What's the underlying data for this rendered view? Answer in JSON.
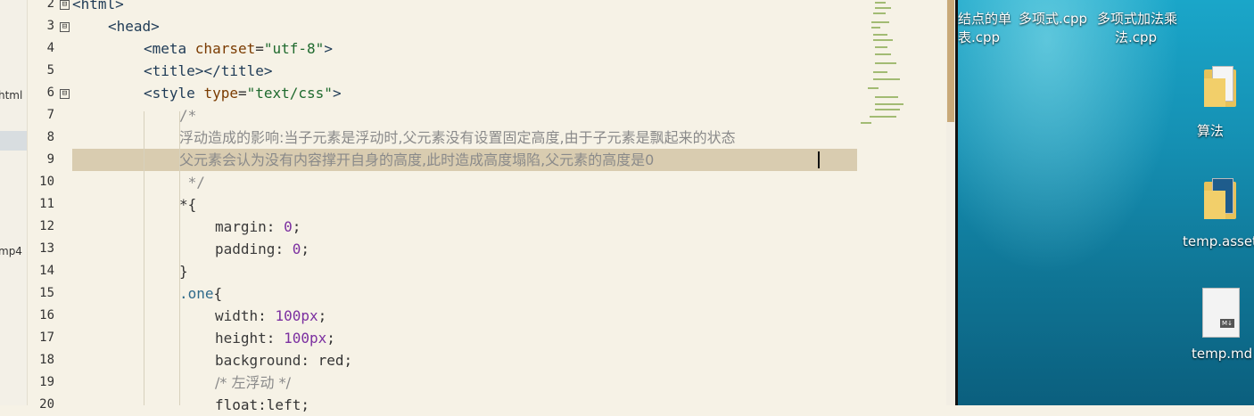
{
  "sidebar": {
    "items": [
      {
        "label": "html"
      },
      {
        "label": "mp4"
      }
    ]
  },
  "editor": {
    "line_numbers": [
      "2",
      "3",
      "4",
      "5",
      "6",
      "7",
      "8",
      "9",
      "10",
      "11",
      "12",
      "13",
      "14",
      "15",
      "16",
      "17",
      "18",
      "19",
      "20"
    ],
    "fold_markers": [
      "⊟",
      "⊟",
      "⊟"
    ],
    "lines": {
      "l2": "<html>",
      "l3": "<head>",
      "l4a": "<meta ",
      "l4b": "charset",
      "l4c": "=",
      "l4d": "\"utf-8\"",
      "l4e": ">",
      "l5": "<title></title>",
      "l6a": "<style ",
      "l6b": "type",
      "l6c": "=",
      "l6d": "\"text/css\"",
      "l6e": ">",
      "l7": "/*",
      "l8": "浮动造成的影响:当子元素是浮动时,父元素没有设置固定高度,由于子元素是飘起来的状态",
      "l9": "父元素会认为没有内容撑开自身的高度,此时造成高度塌陷,父元素的高度是0",
      "l10": " */",
      "l11": "*{",
      "l12a": "margin",
      "l12b": ": ",
      "l12c": "0",
      "l12d": ";",
      "l13a": "padding",
      "l13b": ": ",
      "l13c": "0",
      "l13d": ";",
      "l14": "}",
      "l15a": ".one",
      "l15b": "{",
      "l16a": "width",
      "l16b": ": ",
      "l16c": "100px",
      "l16d": ";",
      "l17a": "height",
      "l17b": ": ",
      "l17c": "100px",
      "l17d": ";",
      "l18a": "background",
      "l18b": ": red;",
      "l19": "/* 左浮动 */",
      "l20": "float:left;"
    }
  },
  "desktop": {
    "top_labels": [
      "结点的单",
      "表.cpp",
      "多项式.cpp",
      "多项式加法乘",
      "法.cpp"
    ],
    "icons": [
      {
        "label": "算法"
      },
      {
        "label": "temp.asset"
      },
      {
        "label": "temp.md"
      }
    ]
  },
  "colors": {
    "editor_bg": "#f6f2e6",
    "highlight": "#d9ccb0",
    "scroll_thumb": "#c9a978",
    "desktop": "#1590b3"
  }
}
